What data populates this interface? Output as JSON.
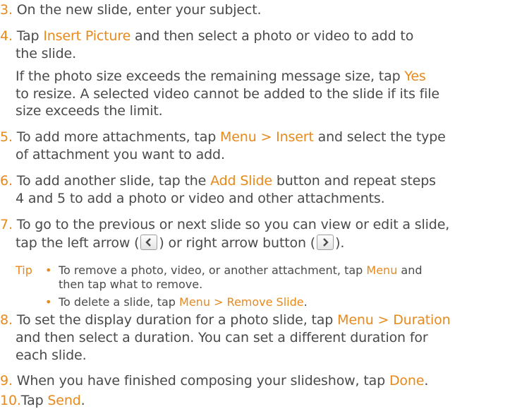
{
  "accent_color": "#e8891c",
  "steps": {
    "s3": {
      "num": "3.",
      "a": "On the new slide, enter your subject."
    },
    "s4": {
      "num": "4.",
      "a": "Tap ",
      "b": "Insert Picture",
      "c": " and then select a photo or video to add to",
      "line2": "the slide.",
      "note1a": "If the photo size exceeds the remaining message size, tap ",
      "note1b": "Yes",
      "note2": "to resize. A selected video cannot be added to the slide if its file",
      "note3": "size exceeds the limit."
    },
    "s5": {
      "num": "5.",
      "a": "To add more attachments, tap ",
      "b": "Menu > Insert",
      "c": " and select the type",
      "line2": "of attachment you want to add."
    },
    "s6": {
      "num": "6.",
      "a": "To add another slide, tap the ",
      "b": "Add Slide",
      "c": " button and repeat steps",
      "line2": "4 and 5 to add a photo or video and other attachments."
    },
    "s7": {
      "num": "7.",
      "a": "To go to the previous or next slide so you can view or edit a slide,",
      "line2a": "tap the left arrow (",
      "line2b": ") or right arrow button (",
      "line2c": ")."
    },
    "tip": {
      "label": "Tip",
      "b1a": "To remove a photo, video, or another attachment, tap ",
      "b1b": "Menu",
      "b1c": " and",
      "b1line2": "then tap what to remove.",
      "b2a": "To delete a slide, tap ",
      "b2b": "Menu > Remove Slide",
      "b2c": "."
    },
    "s8": {
      "num": "8.",
      "a": "To set the display duration for a photo slide, tap ",
      "b": "Menu > Duration",
      "line2": "and then select a duration. You can set a different duration for",
      "line3": "each slide."
    },
    "s9": {
      "num": "9.",
      "a": "When you have finished composing your slideshow, tap ",
      "b": "Done",
      "c": "."
    },
    "s10": {
      "num": "10.",
      "a": "Tap ",
      "b": "Send",
      "c": "."
    }
  }
}
